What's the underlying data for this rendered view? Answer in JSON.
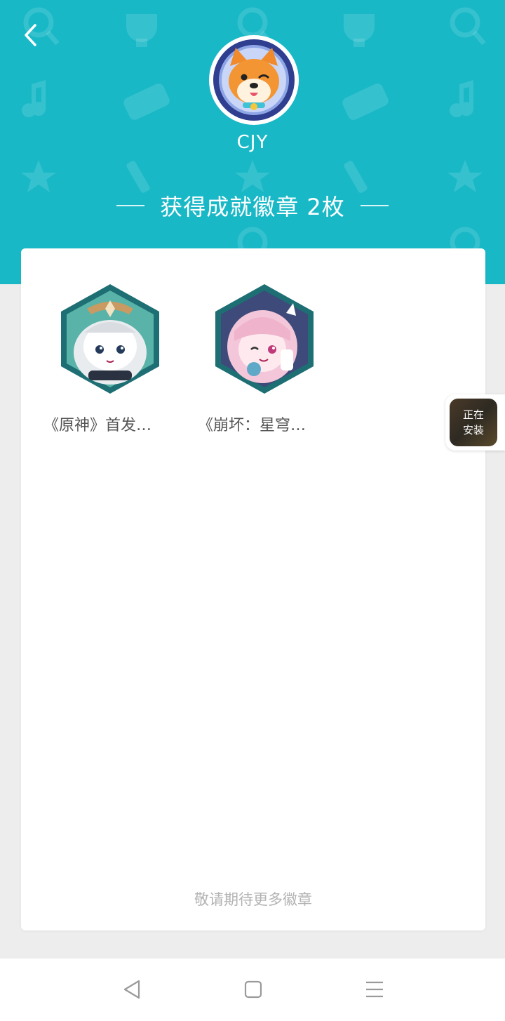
{
  "header": {
    "username": "CJY",
    "badge_count_text": "获得成就徽章 2枚",
    "bg_color": "#19b8c7"
  },
  "badges": [
    {
      "label": "《原神》首发…",
      "icon": "genshin-paimon-badge"
    },
    {
      "label": "《崩坏：星穹…",
      "icon": "honkai-star-rail-march7th-badge"
    }
  ],
  "footer_note": "敬请期待更多徽章",
  "install_float": {
    "text_line1": "正在",
    "text_line2": "安装"
  },
  "nav": {
    "back": "triangle-back-icon",
    "home": "square-home-icon",
    "menu": "lines-menu-icon"
  }
}
